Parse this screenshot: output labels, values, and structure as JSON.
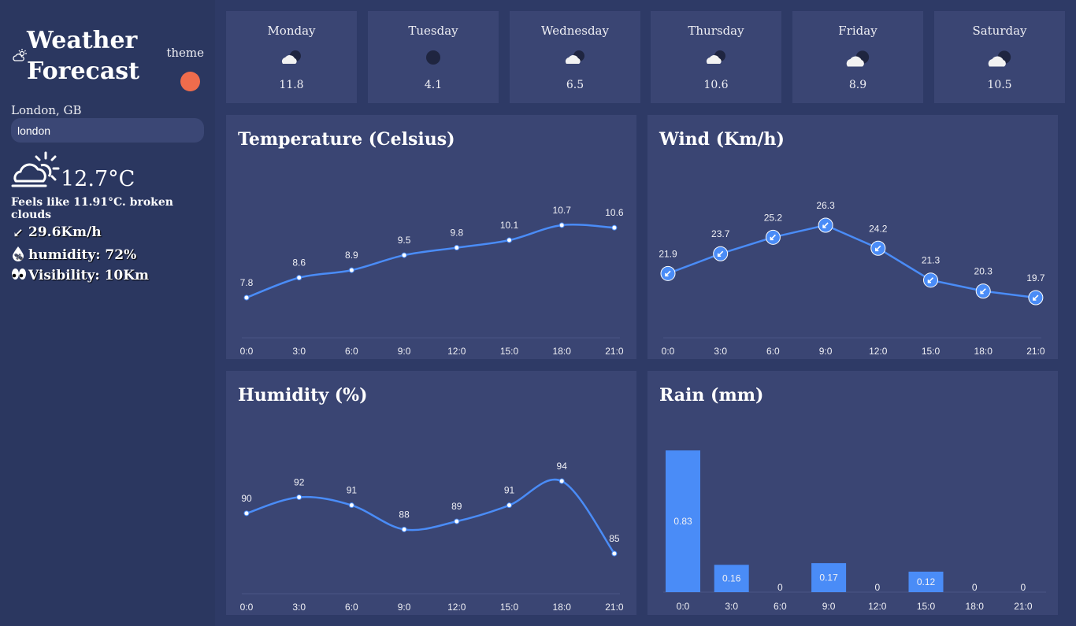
{
  "app": {
    "title_line1": "Weather",
    "title_line2": "Forecast",
    "theme_label": "theme",
    "theme_color": "#ef6c4c"
  },
  "location": "London, GB",
  "search": {
    "value": "london",
    "placeholder": ""
  },
  "current": {
    "temperature": "12.7°C",
    "description": "Feels like 11.91°C. broken clouds",
    "wind": "29.6Km/h",
    "wind_icon": "arrow-down-left-icon",
    "humidity": "humidity: 72%",
    "humidity_icon": "percent-drop-icon",
    "visibility": "Visibility: 10Km",
    "visibility_icon": "eyes-icon",
    "icon": "partly-cloudy-day-icon"
  },
  "forecast": [
    {
      "day": "Monday",
      "temp": "11.8",
      "icon": "cloudy-night-icon"
    },
    {
      "day": "Tuesday",
      "temp": "4.1",
      "icon": "clear-night-icon"
    },
    {
      "day": "Wednesday",
      "temp": "6.5",
      "icon": "cloudy-night-icon"
    },
    {
      "day": "Thursday",
      "temp": "10.6",
      "icon": "cloudy-night-icon"
    },
    {
      "day": "Friday",
      "temp": "8.9",
      "icon": "cloudy-night-icon"
    },
    {
      "day": "Saturday",
      "temp": "10.5",
      "icon": "cloudy-night-icon"
    }
  ],
  "colors": {
    "background": "#2e3a66",
    "sidebar": "#2b3760",
    "panel": "#3a4573",
    "series": "#4a8cf7"
  },
  "chart_data": [
    {
      "type": "line",
      "title": "Temperature (Celsius)",
      "categories": [
        "0:0",
        "3:0",
        "6:0",
        "9:0",
        "12:0",
        "15:0",
        "18:0",
        "21:0"
      ],
      "values": [
        7.8,
        8.6,
        8.9,
        9.5,
        9.8,
        10.1,
        10.7,
        10.6
      ],
      "data_labels": [
        "7.8",
        "8.6",
        "8.9",
        "9.5",
        "9.8",
        "10.1",
        "10.7",
        "10.6"
      ],
      "grid": false,
      "legend": "none"
    },
    {
      "type": "line",
      "title": "Wind (Km/h)",
      "categories": [
        "0:0",
        "3:0",
        "6:0",
        "9:0",
        "12:0",
        "15:0",
        "18:0",
        "21:0"
      ],
      "values": [
        21.9,
        23.7,
        25.2,
        26.3,
        24.2,
        21.3,
        20.3,
        19.7
      ],
      "data_labels": [
        "21.9",
        "23.7",
        "25.2",
        "26.3",
        "24.2",
        "21.3",
        "20.3",
        "19.7"
      ],
      "marker_icon": "wind-direction-arrow-icon",
      "grid": false,
      "legend": "none"
    },
    {
      "type": "line",
      "title": "Humidity (%)",
      "categories": [
        "0:0",
        "3:0",
        "6:0",
        "9:0",
        "12:0",
        "15:0",
        "18:0",
        "21:0"
      ],
      "values": [
        90,
        92,
        91,
        88,
        89,
        91,
        94,
        85
      ],
      "data_labels": [
        "90",
        "92",
        "91",
        "88",
        "89",
        "91",
        "94",
        "85"
      ],
      "grid": false,
      "legend": "none"
    },
    {
      "type": "bar",
      "title": "Rain (mm)",
      "categories": [
        "0:0",
        "3:0",
        "6:0",
        "9:0",
        "12:0",
        "15:0",
        "18:0",
        "21:0"
      ],
      "values": [
        0.83,
        0.16,
        0,
        0.17,
        0,
        0.12,
        0,
        0
      ],
      "data_labels": [
        "0.83",
        "0.16",
        "0",
        "0.17",
        "0",
        "0.12",
        "0",
        "0"
      ],
      "grid": false,
      "legend": "none"
    }
  ]
}
